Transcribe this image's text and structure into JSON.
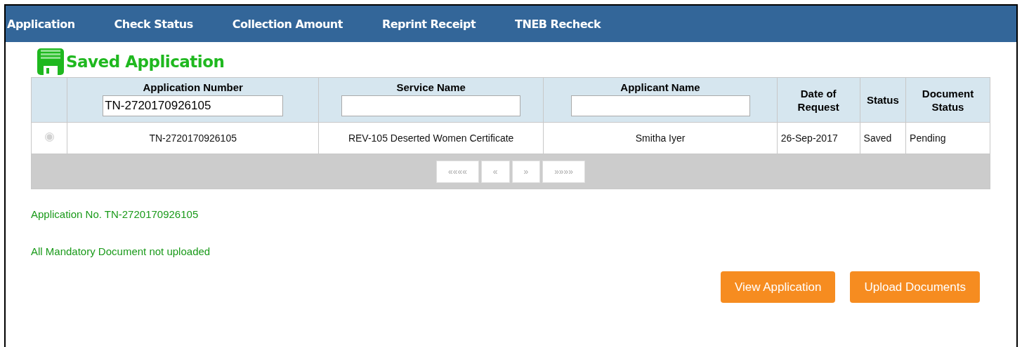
{
  "nav": [
    {
      "label": "Application"
    },
    {
      "label": "Check Status"
    },
    {
      "label": "Collection Amount"
    },
    {
      "label": "Reprint Receipt"
    },
    {
      "label": "TNEB Recheck"
    }
  ],
  "title": "Saved Application",
  "table": {
    "columns": [
      {
        "label": "Application Number",
        "kind": "filter",
        "filter": "TN-2720170926105"
      },
      {
        "label": "Service Name",
        "kind": "filter"
      },
      {
        "label": "Applicant Name",
        "kind": "filter"
      },
      {
        "label": "Date of Request",
        "kind": "plain"
      },
      {
        "label": "Status",
        "kind": "plain"
      },
      {
        "label": "Document Status",
        "kind": "plain"
      }
    ],
    "rows": [
      {
        "selected": true,
        "disabled": true,
        "cells": [
          "TN-2720170926105",
          "REV-105 Deserted Women Certificate",
          "Smitha Iyer",
          "26-Sep-2017",
          "Saved",
          "Pending"
        ]
      }
    ],
    "pager": [
      {
        "label": "««««",
        "disabled": true
      },
      {
        "label": "«",
        "disabled": true
      },
      {
        "label": "»",
        "disabled": true
      },
      {
        "label": "»»»»",
        "disabled": true
      }
    ]
  },
  "messages": [
    "Application No. TN-2720170926105",
    "All Mandatory Document not uploaded"
  ],
  "buttons": [
    "View Application",
    "Upload Documents"
  ]
}
